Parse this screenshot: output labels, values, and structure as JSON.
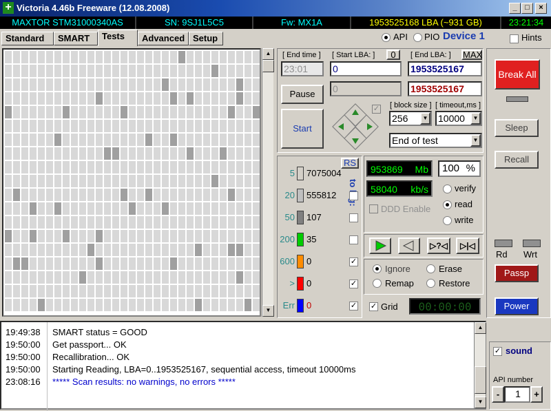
{
  "window": {
    "title": "Victoria 4.46b Freeware (12.08.2008)",
    "app_icon": "plus-icon",
    "min": "_",
    "max": "□",
    "close": "×"
  },
  "infobar": {
    "model": "MAXTOR STM31000340AS",
    "serial": "SN: 9SJ1L5C5",
    "firmware": "Fw: MX1A",
    "capacity": "1953525168 LBA (~931 GB)",
    "clock": "23:21:34"
  },
  "tabs": [
    "Standard",
    "SMART",
    "Tests",
    "Advanced",
    "Setup"
  ],
  "mode": {
    "api": "API",
    "pio": "PIO",
    "device": "Device 1",
    "hints": "Hints"
  },
  "test": {
    "end_time_label": "[ End time ]",
    "end_time": "23:01",
    "start_lba_label": "[ Start LBA: ]",
    "start_lba_btn": "0",
    "start_lba": "0",
    "end_lba_label": "[ End LBA: ]",
    "max_btn": "MAX",
    "end_lba": "1953525167",
    "pos_lba": "1953525167",
    "pos_field": "0",
    "pause": "Pause",
    "start": "Start",
    "block_size_label": "[ block size ]",
    "block_size": "256",
    "timeout_label": "[ timeout,ms ]",
    "timeout": "10000",
    "end_mode": "End of test"
  },
  "stats": {
    "rs": "RS",
    "to_log": "to log:",
    "rows": [
      {
        "ms": "5",
        "count": "7075004",
        "color": "#d4d0c8"
      },
      {
        "ms": "20",
        "count": "555812",
        "color": "#c0c0c0"
      },
      {
        "ms": "50",
        "count": "107",
        "color": "#808080"
      },
      {
        "ms": "200",
        "count": "35",
        "color": "#00cc00"
      },
      {
        "ms": "600",
        "count": "0",
        "color": "#ff8c00"
      },
      {
        "ms": ">",
        "count": "0",
        "color": "#ff0000"
      },
      {
        "ms": "Err",
        "count": "0",
        "color": "#0000ff"
      }
    ]
  },
  "speed": {
    "mb": "953869",
    "mb_unit": "Mb",
    "percent": "100",
    "pct_unit": "%",
    "kbs": "58040",
    "kbs_unit": "kb/s",
    "ddd": "DDD Enable"
  },
  "action": {
    "verify": "verify",
    "read": "read",
    "write": "write"
  },
  "repair": {
    "ignore": "Ignore",
    "erase": "Erase",
    "remap": "Remap",
    "restore": "Restore"
  },
  "grid_label": "Grid",
  "timer": "00:00:00",
  "side": {
    "break_all": "Break All",
    "sleep": "Sleep",
    "recall": "Recall",
    "rd": "Rd",
    "wrt": "Wrt",
    "passp": "Passp",
    "power": "Power",
    "sound": "sound",
    "api_number_label": "API number",
    "api_number": "1",
    "minus": "-",
    "plus": "+"
  },
  "log": [
    {
      "time": "19:49:38",
      "msg": "SMART status = GOOD",
      "color": "#000000"
    },
    {
      "time": "19:50:00",
      "msg": "Get passport... OK",
      "color": "#000000"
    },
    {
      "time": "19:50:00",
      "msg": "Recallibration... OK",
      "color": "#000000"
    },
    {
      "time": "19:50:00",
      "msg": "Starting Reading, LBA=0..1953525167, sequential access, timeout 10000ms",
      "color": "#000000"
    },
    {
      "time": "23:08:16",
      "msg": "***** Scan results: no warnings, no errors *****",
      "color": "#0000cc"
    }
  ]
}
